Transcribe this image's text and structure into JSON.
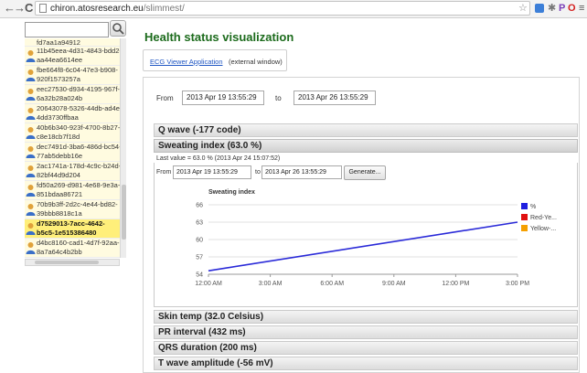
{
  "browser": {
    "back_glyph": "←",
    "forward_glyph": "→",
    "reload_glyph": "C",
    "url_domain": "chiron.atosresearch.eu",
    "url_path": "/slimmest/",
    "star_glyph": "☆",
    "ext_p_glyph": "P",
    "ext_o_glyph": "O",
    "menu_glyph": "≡"
  },
  "sidebar": {
    "patients": [
      {
        "line1": "fd7aa1a94912",
        "line2": ""
      },
      {
        "line1": "11b45eea-4d31-4843-bdd2-",
        "line2": "aa44ea6614ee"
      },
      {
        "line1": "fbe664f8-6c04-47e3-b908-",
        "line2": "920f1573257a"
      },
      {
        "line1": "eec27530-d934-4195-967f-",
        "line2": "6a32b28a024b"
      },
      {
        "line1": "20643078-5326-44db-ad4e-",
        "line2": "4dd3730ffbaa"
      },
      {
        "line1": "40b6b340-923f-4700-8b27-",
        "line2": "c8e18cb7f18d"
      },
      {
        "line1": "dec7491d-3ba6-486d-bc54-",
        "line2": "77ab5debb16e"
      },
      {
        "line1": "2ac1741a-178d-4c9c-b24d-",
        "line2": "82bf44d9d204"
      },
      {
        "line1": "fd50a269-d981-4e68-9e3a-",
        "line2": "851bdaa86721"
      },
      {
        "line1": "70b9b3ff-2d2c-4e44-bd82-",
        "line2": "39bbb8818c1a"
      },
      {
        "line1": "d7529013-7acc-4642-",
        "line2": "b5c5-1e515386480"
      },
      {
        "line1": "d4bc8160-cad1-4d7f-92aa-",
        "line2": "8a7a64c4b2bb"
      }
    ],
    "selected_index": 10
  },
  "main": {
    "title": "Health status visualization",
    "ecg_link": "ECG Viewer Application",
    "ecg_note": "(external window)",
    "from_label": "From",
    "to_label": "to",
    "from_value": "2013 Apr 19 13:55:29",
    "to_value": "2013 Apr 26 13:55:29"
  },
  "sections": {
    "q_wave": "Q wave (-177 code)",
    "sweating": "Sweating index (63.0 %)",
    "skin_temp": "Skin temp (32.0 Celsius)",
    "pr_interval": "PR interval (432 ms)",
    "qrs": "QRS duration (200 ms)",
    "t_wave": "T wave amplitude (-56 mV)"
  },
  "sweating_panel": {
    "last_value": "Last value = 63.0 % (2013 Apr 24 15:07:52)",
    "from_label": "From",
    "to_label": "to",
    "from_value": "2013 Apr 19 13:55:29",
    "to_value": "2013 Apr 26 13:55:29",
    "generate_label": "Generate..."
  },
  "chart_data": {
    "type": "line",
    "title": "Sweating index",
    "xlabel": "",
    "ylabel": "",
    "x_ticks": [
      "12:00 AM",
      "3:00 AM",
      "6:00 AM",
      "9:00 AM",
      "12:00 PM",
      "3:00 PM"
    ],
    "y_ticks": [
      54,
      57,
      60,
      63,
      66
    ],
    "ylim": [
      54,
      66
    ],
    "grid": true,
    "legend_position": "right",
    "legend": [
      {
        "label": "%",
        "color": "#1f1fe0"
      },
      {
        "label": "Red-Ye...",
        "color": "#e01010"
      },
      {
        "label": "Yellow-...",
        "color": "#f5a000"
      }
    ],
    "series": [
      {
        "name": "%",
        "color": "#2a2ad8",
        "points": [
          {
            "x": "12:00 AM",
            "y": 54.6
          },
          {
            "x": "3:00 PM",
            "y": 63.0
          }
        ]
      }
    ]
  }
}
